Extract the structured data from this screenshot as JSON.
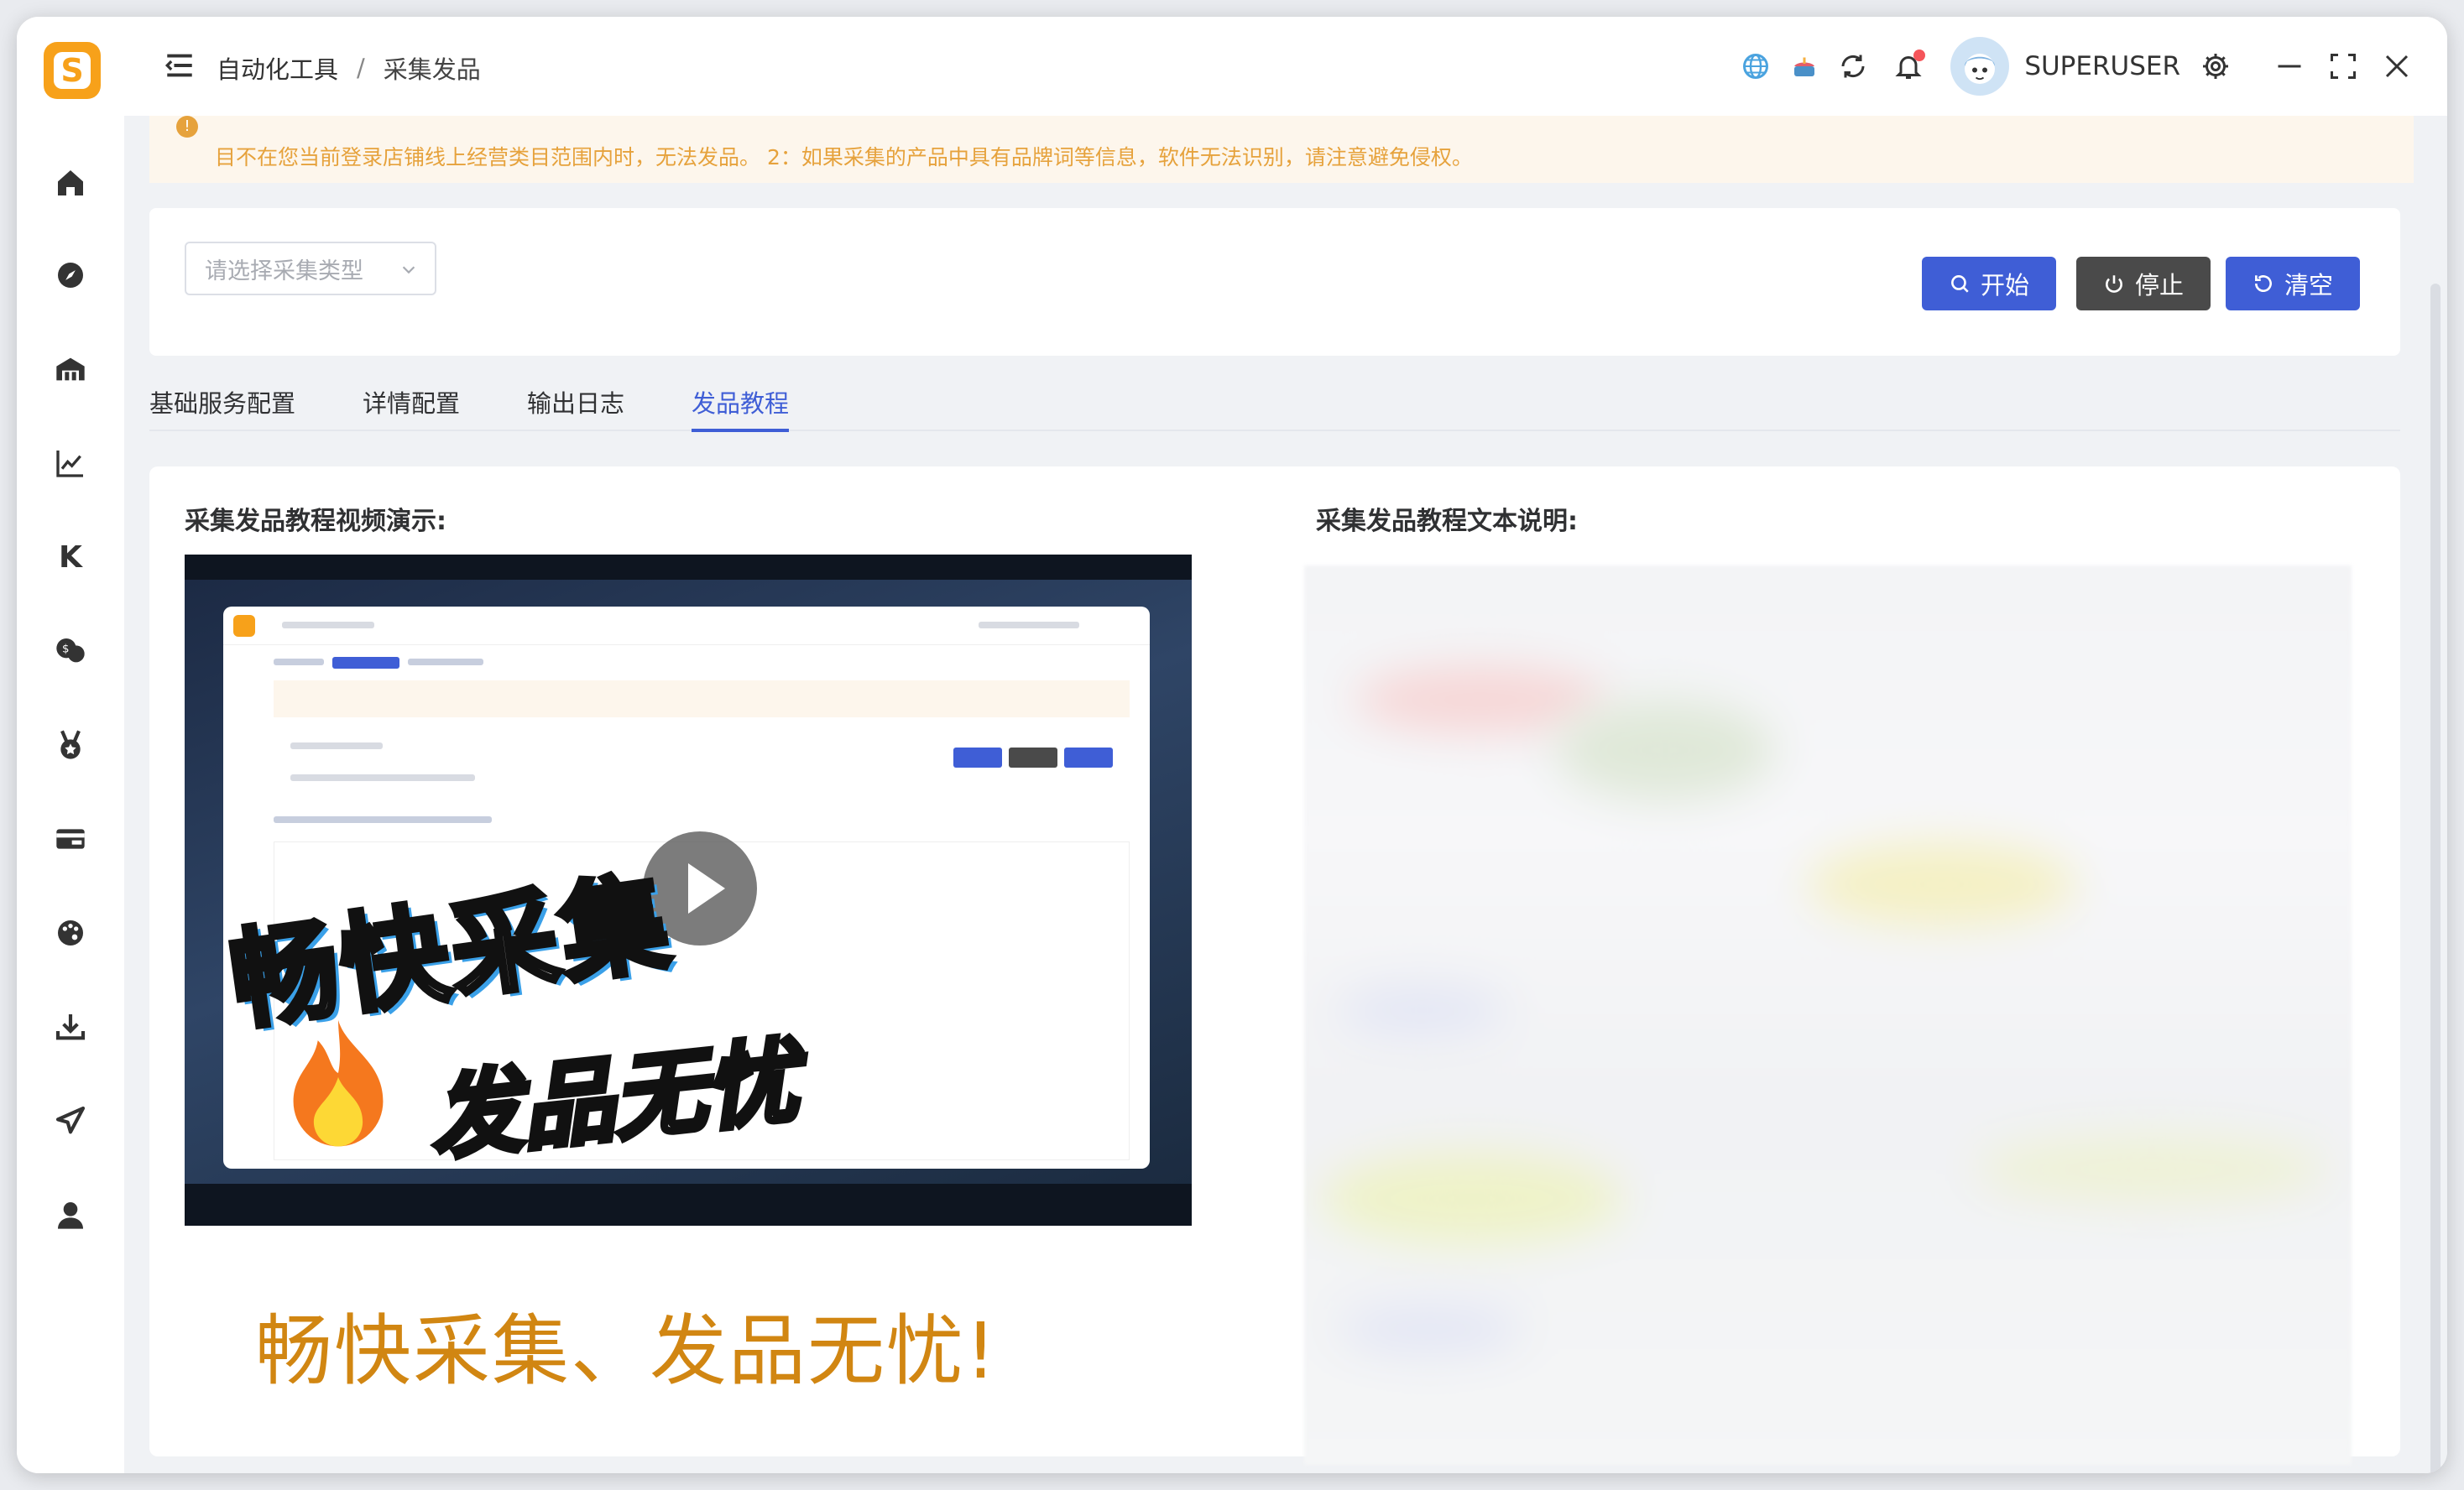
{
  "header": {
    "breadcrumb": [
      "自动化工具",
      "采集发品"
    ],
    "breadcrumb_sep": "/",
    "username": "SUPERUSER"
  },
  "alert": {
    "text": "目不在您当前登录店铺线上经营类目范围内时，无法发品。 2：如果采集的产品中具有品牌词等信息，软件无法识别，请注意避免侵权。",
    "color": "#e6a23c"
  },
  "toolbar": {
    "select_placeholder": "请选择采集类型",
    "start_label": "开始",
    "stop_label": "停止",
    "clear_label": "清空"
  },
  "tabs": [
    {
      "label": "基础服务配置",
      "active": false
    },
    {
      "label": "详情配置",
      "active": false
    },
    {
      "label": "输出日志",
      "active": false
    },
    {
      "label": "发品教程",
      "active": true
    }
  ],
  "tutorial": {
    "video_title": "采集发品教程视频演示:",
    "text_title": "采集发品教程文本说明:",
    "overlay_line1": "畅快采集",
    "overlay_line2": "发品无忧",
    "slogan": "畅快采集、发品无忧!"
  },
  "sidebar": {
    "icons": [
      "home-icon",
      "compass-icon",
      "warehouse-icon",
      "chart-icon",
      "k-icon",
      "chat-icon",
      "medal-icon",
      "card-icon",
      "palette-icon",
      "download-icon",
      "send-icon",
      "user-icon"
    ],
    "k_label": "K"
  },
  "colors": {
    "brand": "#f7a11a",
    "primary": "#3f5ed6",
    "stop": "#4a4a4a",
    "slogan": "#d18612"
  }
}
